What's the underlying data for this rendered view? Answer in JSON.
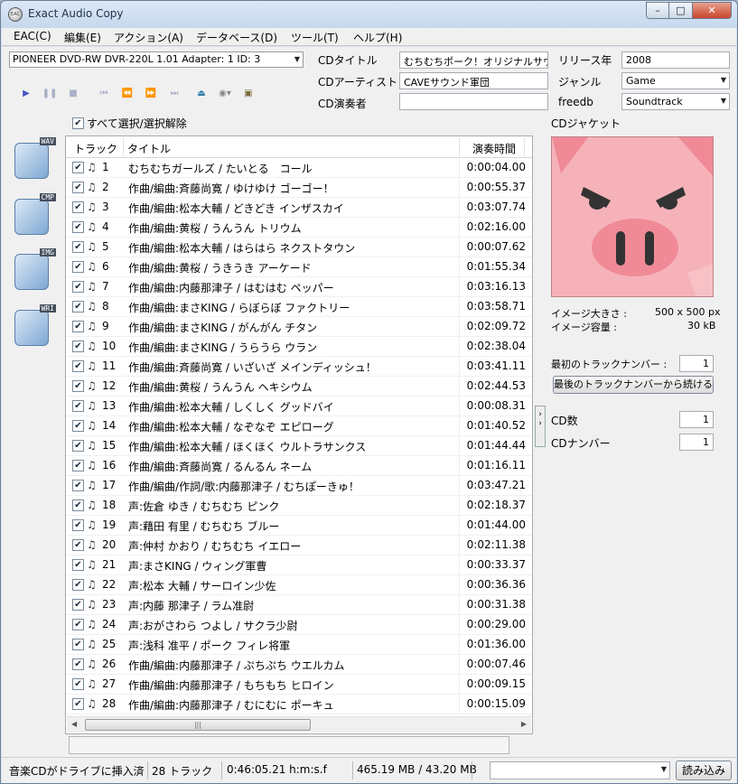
{
  "window": {
    "title": "Exact Audio Copy",
    "icon_text": "EAC"
  },
  "menu": [
    "EAC(C)",
    "編集(E)",
    "アクション(A)",
    "データベース(D)",
    "ツール(T)",
    "ヘルプ(H)"
  ],
  "drive": {
    "selected": "PIONEER DVD-RW  DVR-220L 1.01   Adapter: 1  ID: 3"
  },
  "select_all_label": "すべて選択/選択解除",
  "side_icons": [
    "WAV",
    "CMP",
    "IMG",
    "WRI"
  ],
  "tracklist": {
    "col_track": "トラック",
    "col_title": "タイトル",
    "col_time": "演奏時間",
    "tracks": [
      {
        "num": "1",
        "title": "むちむちガールズ / たいとる　コール",
        "time": "0:00:04.00"
      },
      {
        "num": "2",
        "title": "作曲/編曲:斉藤尚寛 / ゆけゆけ ゴーゴー！",
        "time": "0:00:55.37"
      },
      {
        "num": "3",
        "title": "作曲/編曲:松本大輔 / どきどき インザスカイ",
        "time": "0:03:07.74"
      },
      {
        "num": "4",
        "title": "作曲/編曲:黄桜 / うんうん トリウム",
        "time": "0:02:16.00"
      },
      {
        "num": "5",
        "title": "作曲/編曲:松本大輔 / はらはら ネクストタウン",
        "time": "0:00:07.62"
      },
      {
        "num": "6",
        "title": "作曲/編曲:黄桜 / うきうき アーケード",
        "time": "0:01:55.34"
      },
      {
        "num": "7",
        "title": "作曲/編曲:内藤那津子 / はむはむ ペッパー",
        "time": "0:03:16.13"
      },
      {
        "num": "8",
        "title": "作曲/編曲:まさKING / らぼらぼ ファクトリー",
        "time": "0:03:58.71"
      },
      {
        "num": "9",
        "title": "作曲/編曲:まさKING / がんがん チタン",
        "time": "0:02:09.72"
      },
      {
        "num": "10",
        "title": "作曲/編曲:まさKING / うらうら ウラン",
        "time": "0:02:38.04"
      },
      {
        "num": "11",
        "title": "作曲/編曲:斉藤尚寛 / いざいざ メインディッシュ！",
        "time": "0:03:41.11"
      },
      {
        "num": "12",
        "title": "作曲/編曲:黄桜 / うんうん ヘキシウム",
        "time": "0:02:44.53"
      },
      {
        "num": "13",
        "title": "作曲/編曲:松本大輔 / しくしく グッドバイ",
        "time": "0:00:08.31"
      },
      {
        "num": "14",
        "title": "作曲/編曲:松本大輔 / なぞなぞ エピローグ",
        "time": "0:01:40.52"
      },
      {
        "num": "15",
        "title": "作曲/編曲:松本大輔 / ほくほく ウルトラサンクス",
        "time": "0:01:44.44"
      },
      {
        "num": "16",
        "title": "作曲/編曲:斉藤尚寛 / るんるん ネーム",
        "time": "0:01:16.11"
      },
      {
        "num": "17",
        "title": "作曲/編曲/作詞/歌:内藤那津子 / むちぽーきゅ！",
        "time": "0:03:47.21"
      },
      {
        "num": "18",
        "title": "声:佐倉 ゆき / むちむち ピンク",
        "time": "0:02:18.37"
      },
      {
        "num": "19",
        "title": "声:藉田 有里 / むちむち ブルー",
        "time": "0:01:44.00"
      },
      {
        "num": "20",
        "title": "声:仲村 かおり / むちむち イエロー",
        "time": "0:02:11.38"
      },
      {
        "num": "21",
        "title": "声:まさKING / ウィング軍曹",
        "time": "0:00:33.37"
      },
      {
        "num": "22",
        "title": "声:松本 大輔 / サーロイン少佐",
        "time": "0:00:36.36"
      },
      {
        "num": "23",
        "title": "声:内藤 那津子 / ラム准尉",
        "time": "0:00:31.38"
      },
      {
        "num": "24",
        "title": "声:おがさわら つよし / サクラ少尉",
        "time": "0:00:29.00"
      },
      {
        "num": "25",
        "title": "声:浅科 准平 / ポーク フィレ将軍",
        "time": "0:01:36.00"
      },
      {
        "num": "26",
        "title": "作曲/編曲:内藤那津子 / ぷちぷち ウエルカム",
        "time": "0:00:07.46"
      },
      {
        "num": "27",
        "title": "作曲/編曲:内藤那津子 / もちもち ヒロイン",
        "time": "0:00:09.15"
      },
      {
        "num": "28",
        "title": "作曲/編曲:内藤那津子 / むにむに ポーキュ",
        "time": "0:00:15.09"
      }
    ]
  },
  "meta": {
    "cd_title_label": "CDタイトル",
    "cd_title": "むちむちポーク！オリジナルサウンドトラック",
    "cd_artist_label": "CDアーティスト",
    "cd_artist": "CAVEサウンド軍団",
    "cd_performer_label": "CD演奏者",
    "cd_performer": "",
    "year_label": "リリース年",
    "year": "2008",
    "genre_label": "ジャンル",
    "genre": "Game",
    "freedb_label": "freedb",
    "freedb": "Soundtrack",
    "cover_label": "CDジャケット",
    "image_size_label": "イメージ大きさ :",
    "image_size": "500 x 500 px",
    "image_bytes_label": "イメージ容量 :",
    "image_bytes": "30 kB",
    "first_track_label": "最初のトラックナンバー :",
    "first_track": "1",
    "continue_button": "最後のトラックナンバーから続ける",
    "cd_count_label": "CD数",
    "cd_count": "1",
    "cd_number_label": "CDナンバー",
    "cd_number": "1"
  },
  "status": {
    "disc_state": "音楽CDがドライブに挿入済",
    "tracks": "28 トラック",
    "length": "0:46:05.21 h:m:s.f",
    "size": "465.19 MB /  43.20 MB",
    "load_button": "読み込み"
  },
  "colors": {
    "cover_bg": "#f6b2b9",
    "cover_pig": "#f08a97",
    "accent": "#4a55c8"
  }
}
